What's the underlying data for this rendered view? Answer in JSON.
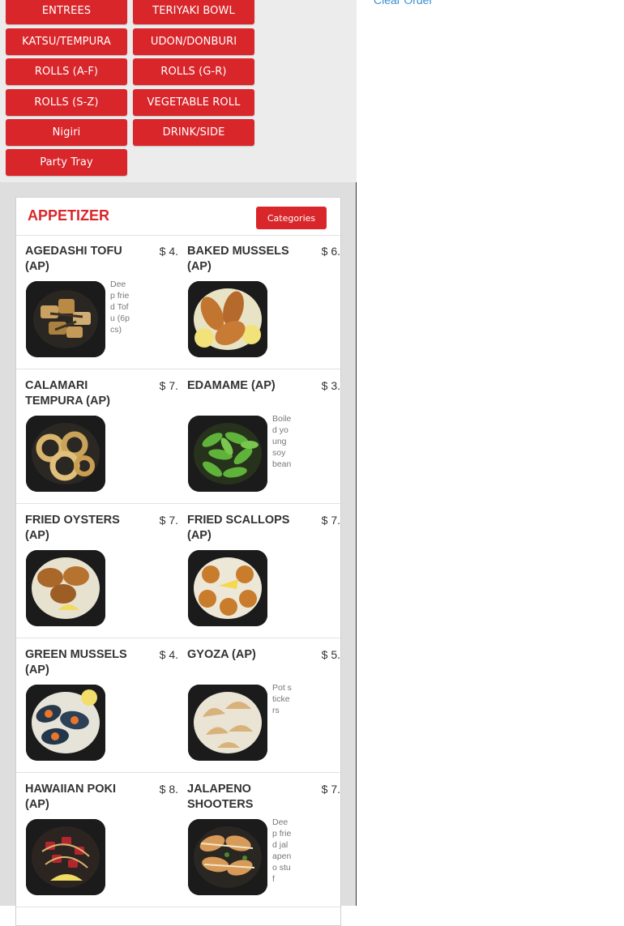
{
  "categories": [
    "ENTREES",
    "TERIYAKI BOWL",
    "KATSU/TEMPURA",
    "UDON/DONBURI",
    "ROLLS (A-F)",
    "ROLLS (G-R)",
    "ROLLS (S-Z)",
    "VEGETABLE ROLL",
    "Nigiri",
    "DRINK/SIDE",
    "Party Tray"
  ],
  "clear_order_label": "Clear Order",
  "section": {
    "title": "APPETIZER",
    "categories_button": "Categories"
  },
  "items": [
    {
      "name": "AGEDASHI TOFU (AP)",
      "price": "$ 4.",
      "desc": "Deep fried Tofu (6pcs)",
      "img": "tofu"
    },
    {
      "name": "BAKED MUSSELS (AP)",
      "price": "$ 6.",
      "desc": "",
      "img": "mussels"
    },
    {
      "name": "CALAMARI TEMPURA (AP)",
      "price": "$ 7.",
      "desc": "",
      "img": "calamari"
    },
    {
      "name": "EDAMAME (AP)",
      "price": "$ 3.",
      "desc": "Boiled young soy bean",
      "img": "edamame"
    },
    {
      "name": "FRIED OYSTERS (AP)",
      "price": "$ 7.",
      "desc": "",
      "img": "oysters"
    },
    {
      "name": "FRIED SCALLOPS (AP)",
      "price": "$ 7.",
      "desc": "",
      "img": "scallops"
    },
    {
      "name": "GREEN MUSSELS (AP)",
      "price": "$ 4.",
      "desc": "",
      "img": "greenmussels"
    },
    {
      "name": "GYOZA (AP)",
      "price": "$ 5.",
      "desc": "Pot stickers",
      "img": "gyoza"
    },
    {
      "name": "HAWAIIAN POKI (AP)",
      "price": "$ 8.",
      "desc": "",
      "img": "poki"
    },
    {
      "name": "JALAPENO SHOOTERS",
      "price": "$ 7.",
      "desc": "Deep fried jalapeno stuf",
      "img": "jalapeno"
    }
  ]
}
